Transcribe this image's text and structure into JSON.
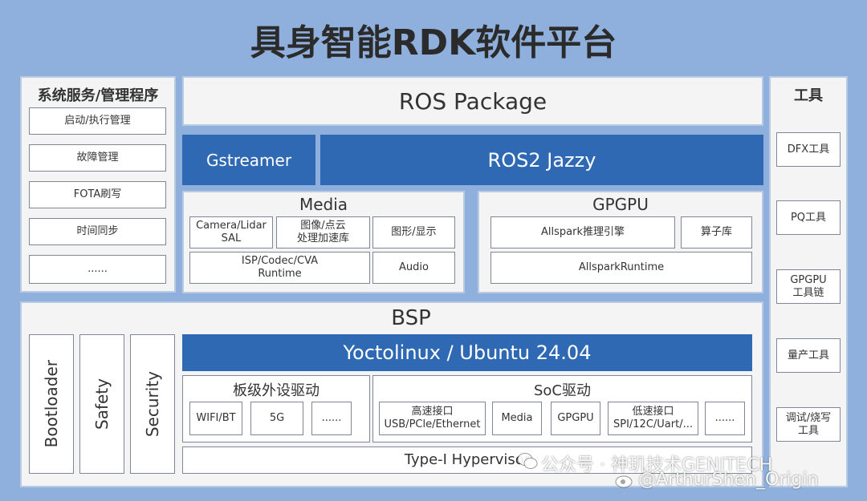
{
  "title": "具身智能RDK软件平台",
  "left_panel": {
    "title": "系统服务/管理程序",
    "items": [
      "启动/执行管理",
      "故障管理",
      "FOTA刷写",
      "时间同步",
      "......"
    ]
  },
  "ros_package": "ROS Package",
  "gstreamer": "Gstreamer",
  "ros2": "ROS2 Jazzy",
  "media": {
    "title": "Media",
    "camera": "Camera/Lidar\nSAL",
    "image_accel": "图像/点云\n处理加速库",
    "graphics": "图形/显示",
    "isp": "ISP/Codec/CVA\nRuntime",
    "audio": "Audio"
  },
  "gpgpu": {
    "title": "GPGPU",
    "allspark_engine": "Allspark推理引擎",
    "operator_lib": "算子库",
    "allspark_runtime": "AllsparkRuntime"
  },
  "bsp": {
    "title": "BSP",
    "bootloader": "Bootloader",
    "safety": "Safety",
    "security": "Security",
    "os": "Yoctolinux / Ubuntu 24.04",
    "board": {
      "title": "板级外设驱动",
      "items": [
        "WIFI/BT",
        "5G",
        "......"
      ]
    },
    "soc": {
      "title": "SoC驱动",
      "highspeed": "高速接口\nUSB/PCle/Ethernet",
      "media": "Media",
      "gpgpu": "GPGPU",
      "lowspeed": "低速接口\nSPI/12C/Uart/...",
      "more": "......"
    },
    "hypervisor": "Type-I Hypervisor"
  },
  "tools": {
    "title": "工具",
    "items": [
      "DFX工具",
      "PQ工具",
      "GPGPU\n工具链",
      "量产工具",
      "调试/烧写\n工具"
    ]
  },
  "watermark": {
    "line1": "公众号 · 神玑技术GENITECH",
    "line2": "@ArthurShen_Origin"
  }
}
